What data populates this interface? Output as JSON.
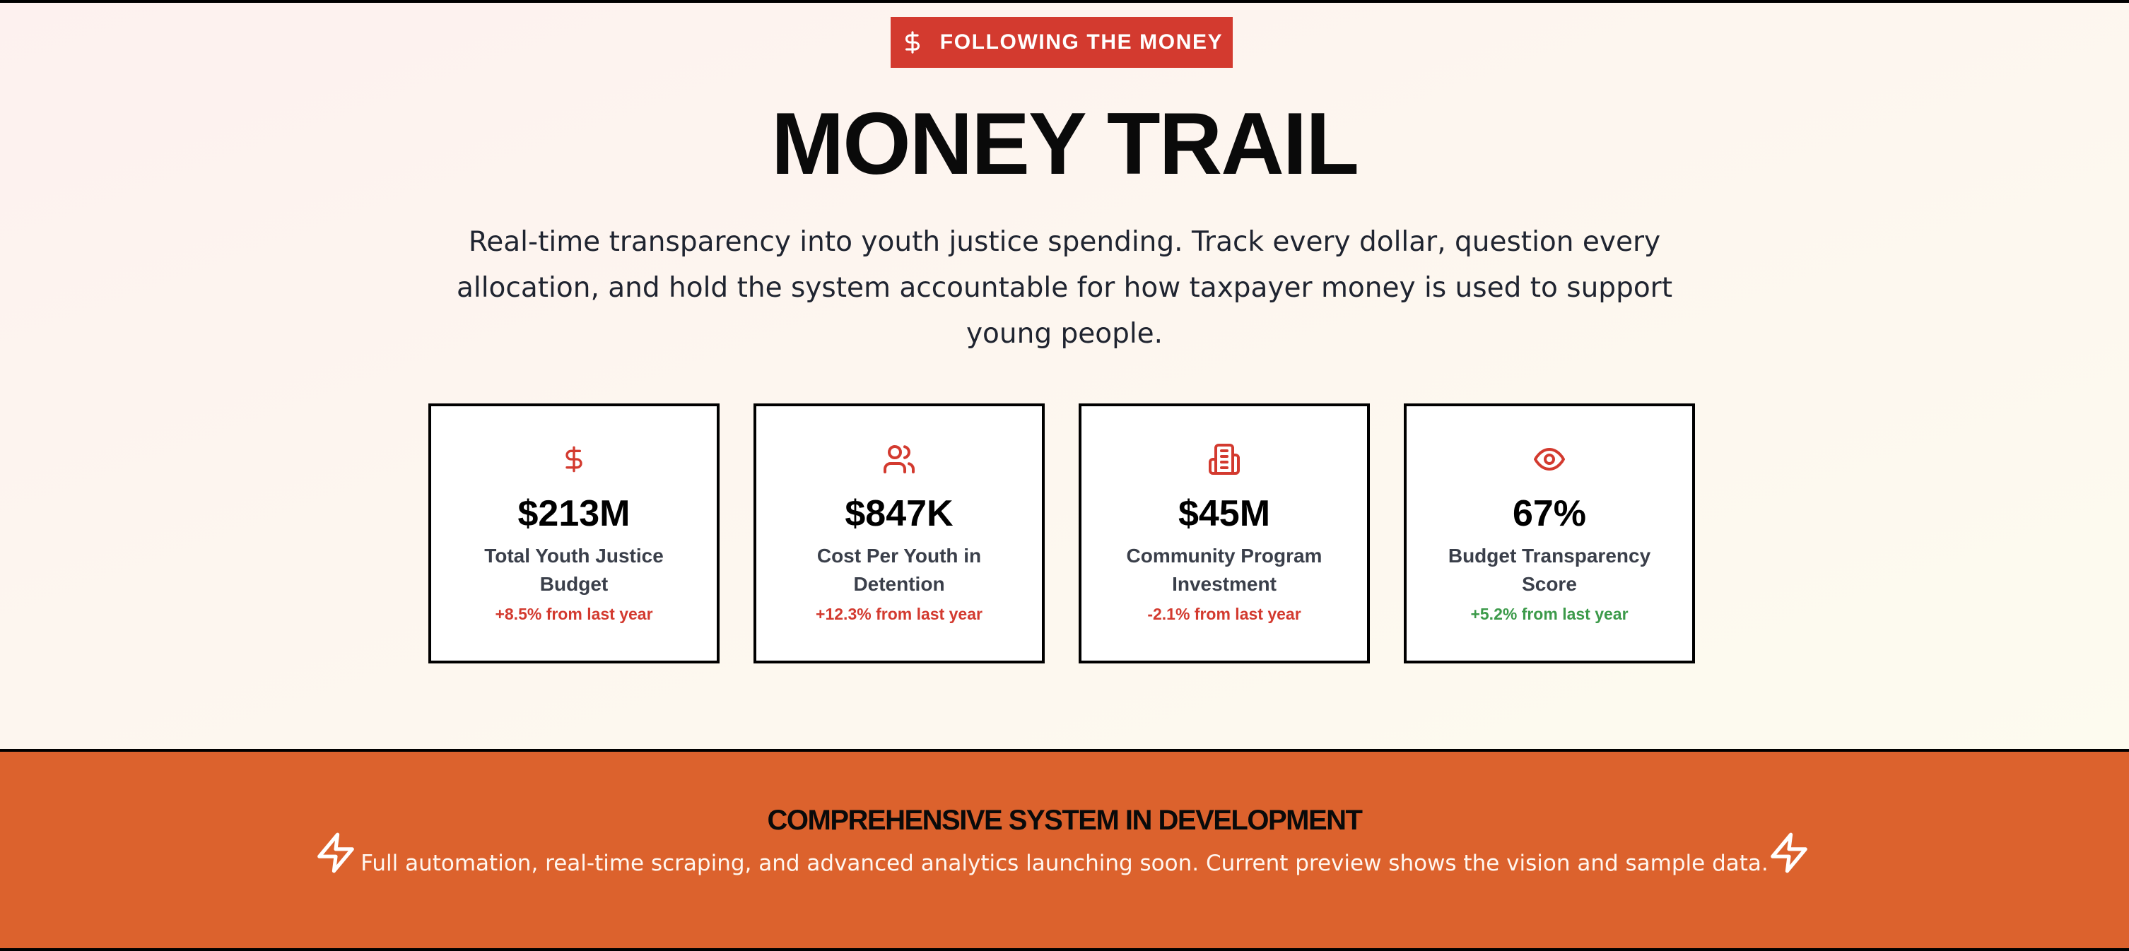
{
  "badge": {
    "label": "FOLLOWING THE MONEY",
    "icon": "dollar-icon"
  },
  "hero": {
    "title": "MONEY TRAIL",
    "description": "Real-time transparency into youth justice spending. Track every dollar, question every allocation, and hold the system accountable for how taxpayer money is used to support young people."
  },
  "stats": [
    {
      "icon": "dollar-icon",
      "value": "$213M",
      "label": "Total Youth Justice Budget",
      "change": "+8.5% from last year",
      "trend": "negative"
    },
    {
      "icon": "users-icon",
      "value": "$847K",
      "label": "Cost Per Youth in Detention",
      "change": "+12.3% from last year",
      "trend": "negative"
    },
    {
      "icon": "building-icon",
      "value": "$45M",
      "label": "Community Program Investment",
      "change": "-2.1% from last year",
      "trend": "negative"
    },
    {
      "icon": "eye-icon",
      "value": "67%",
      "label": "Budget Transparency Score",
      "change": "+5.2% from last year",
      "trend": "positive"
    }
  ],
  "banner": {
    "title": "COMPREHENSIVE SYSTEM IN DEVELOPMENT",
    "text": "Full automation, real-time scraping, and advanced analytics launching soon. Current preview shows the vision and sample data.",
    "icon": "lightning-icon"
  },
  "colors": {
    "accent_red": "#d33a2f",
    "banner_orange": "#dc622d",
    "positive_green": "#3c9a4a"
  }
}
